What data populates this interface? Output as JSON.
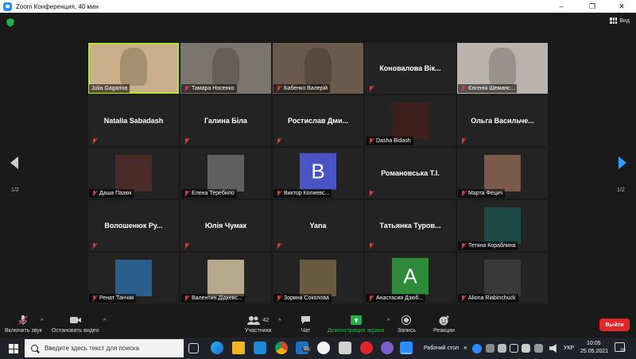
{
  "window": {
    "title": "Zoom Конференция, 40 мин",
    "minimize": "–",
    "maximize": "❐",
    "close": "✕"
  },
  "meeting": {
    "view_label": "Вид",
    "page_left": "1/2",
    "page_right": "1/2",
    "tiles": [
      {
        "name": "Julia Gagarina",
        "type": "video",
        "active": true,
        "muted": false,
        "bg": "#c9b08a",
        "icon": "person-video"
      },
      {
        "name": "Тамара Носенко",
        "type": "video",
        "muted": true,
        "bg": "#7a756f",
        "icon": "person-video"
      },
      {
        "name": "Бабенко Валерій",
        "type": "video",
        "muted": true,
        "bg": "#6b5a4c",
        "icon": "person-video"
      },
      {
        "name": "Коновалова Вік...",
        "type": "name",
        "muted": true
      },
      {
        "name": "Євгенія Шеманс...",
        "type": "video",
        "muted": true,
        "bg": "#b9b3ac",
        "icon": "person-video"
      },
      {
        "name": "Natalia Sabadash",
        "type": "name",
        "muted": true
      },
      {
        "name": "Галина Біла",
        "type": "name",
        "muted": true
      },
      {
        "name": "Ростислав Дми...",
        "type": "name",
        "muted": true
      },
      {
        "name": "Dasha Bidash",
        "type": "photo",
        "muted": true,
        "bg": "#3d1f1c",
        "icon": "person-photo"
      },
      {
        "name": "Ольга Васильче...",
        "type": "name",
        "muted": true
      },
      {
        "name": "Даша Пазюк",
        "type": "photo",
        "muted": true,
        "bg": "#4a2b27",
        "icon": "person-photo"
      },
      {
        "name": "Елена Теребило",
        "type": "photo",
        "muted": true,
        "bg": "#5f5f5f",
        "icon": "person-photo"
      },
      {
        "name": "Виктор Колиевс...",
        "type": "letter",
        "letter": "B",
        "muted": true,
        "bg": "#4b54c4",
        "icon": "letter-avatar"
      },
      {
        "name": "Романовська Т.І.",
        "type": "name",
        "muted": true
      },
      {
        "name": "Марта Фецич",
        "type": "photo",
        "muted": true,
        "bg": "#7a5a4a",
        "icon": "person-photo"
      },
      {
        "name": "Волошенюк Ру...",
        "type": "name",
        "muted": true
      },
      {
        "name": "Юлія Чумак",
        "type": "name",
        "muted": true
      },
      {
        "name": "Yana",
        "type": "name",
        "muted": true
      },
      {
        "name": "Татьянка Туров...",
        "type": "name",
        "muted": true
      },
      {
        "name": "Тетяна Кораблина",
        "type": "photo",
        "muted": true,
        "bg": "#1d4a45",
        "icon": "leaf-photo"
      },
      {
        "name": "Ренат Танчик",
        "type": "photo",
        "muted": true,
        "bg": "#2c5e8c",
        "icon": "person-photo"
      },
      {
        "name": "Валентин Дідкевс...",
        "type": "photo",
        "muted": true,
        "bg": "#b8a98e",
        "icon": "person-photo"
      },
      {
        "name": "Зоряна Соколова",
        "type": "photo",
        "muted": true,
        "bg": "#6a5a40",
        "icon": "person-photo"
      },
      {
        "name": "Анастасия Дзюб...",
        "type": "letter",
        "letter": "A",
        "muted": true,
        "bg": "#2f8a3a",
        "icon": "letter-avatar"
      },
      {
        "name": "Aliona Riabinchuck",
        "type": "photo",
        "muted": true,
        "bg": "#3a3a3a",
        "icon": "person-photo"
      }
    ]
  },
  "toolbar": {
    "unmute": "Включить звук",
    "start_video": "Остановить видео",
    "participants": "Участники",
    "participants_count": "42",
    "chat": "Чат",
    "share": "Демонстрация экрана",
    "record": "Запись",
    "reactions": "Реакции",
    "leave": "Выйти",
    "caret": "^"
  },
  "taskbar": {
    "search_placeholder": "Введите здесь текст для поиска",
    "badge": "95",
    "desktop": "Рабочий стол",
    "chevron": "»",
    "lang": "УКР",
    "time": "10:05",
    "date": "25.05.2021",
    "notif_count": "20"
  },
  "colors": {
    "accent_blue": "#2d8cff",
    "active_speaker": "#b6e336",
    "leave_red": "#e02828",
    "share_green": "#22b14c",
    "muted_red": "#e8353a"
  }
}
